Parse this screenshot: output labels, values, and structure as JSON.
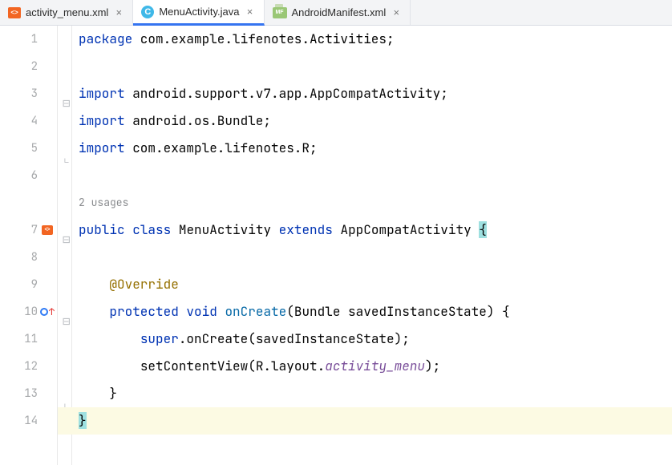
{
  "tabs": [
    {
      "label": "activity_menu.xml",
      "icon": "xml-orange",
      "iconText": "<>",
      "active": false
    },
    {
      "label": "MenuActivity.java",
      "icon": "java-c",
      "iconText": "C",
      "active": true
    },
    {
      "label": "AndroidManifest.xml",
      "icon": "mf",
      "iconText": "MF",
      "active": false
    }
  ],
  "gutter": [
    "1",
    "2",
    "3",
    "4",
    "5",
    "6",
    "",
    "7",
    "8",
    "9",
    "10",
    "11",
    "12",
    "13",
    "14"
  ],
  "markerTagText": "<>",
  "inlay_usages": "2 usages",
  "code": {
    "l1": {
      "kw": "package",
      "rest": " com.example.lifenotes.Activities;"
    },
    "l3": {
      "kw": "import",
      "rest": " android.support.v7.app.AppCompatActivity;"
    },
    "l4": {
      "kw": "import",
      "rest": " android.os.Bundle;"
    },
    "l5": {
      "kw": "import",
      "rest": " com.example.lifenotes.R;"
    },
    "l7": {
      "kw1": "public",
      "kw2": "class",
      "cls": "MenuActivity",
      "kw3": "extends",
      "sup": "AppCompatActivity",
      "brace": "{"
    },
    "l9": {
      "indent": "    ",
      "annot": "@Override"
    },
    "l10": {
      "indent": "    ",
      "kw1": "protected",
      "kw2": "void",
      "method": "onCreate",
      "params": "(Bundle savedInstanceState) {"
    },
    "l11": {
      "indent": "        ",
      "kw": "super",
      "rest1": ".onCreate(savedInstanceState);"
    },
    "l12": {
      "indent": "        ",
      "pre": "setContentView(R.layout.",
      "italic": "activity_menu",
      "post": ");"
    },
    "l13": {
      "indent": "    ",
      "brace": "}"
    },
    "l14": {
      "brace": "}"
    }
  }
}
